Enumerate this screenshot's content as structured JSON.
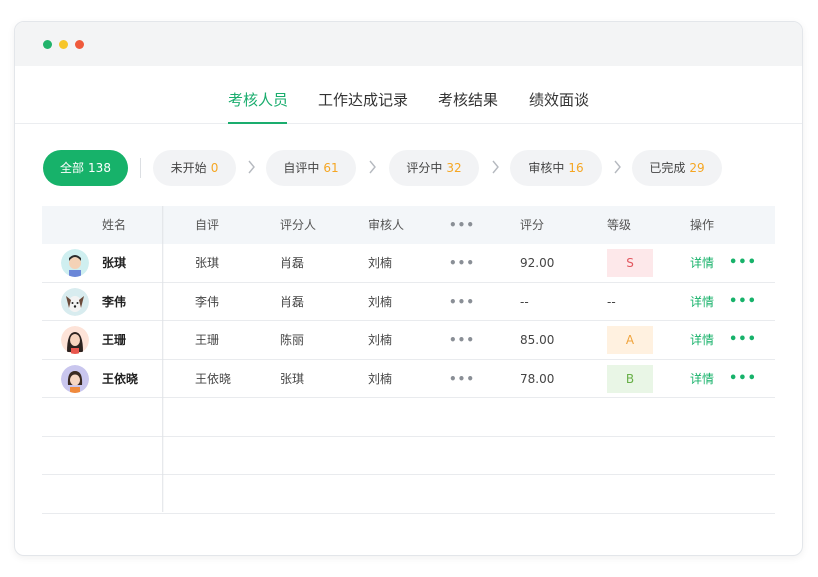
{
  "window": {
    "traffic_lights": [
      "#21b36b",
      "#f7c62a",
      "#ef5a3c"
    ]
  },
  "tabs": [
    {
      "label": "考核人员",
      "active": true
    },
    {
      "label": "工作达成记录",
      "active": false
    },
    {
      "label": "考核结果",
      "active": false
    },
    {
      "label": "绩效面谈",
      "active": false
    }
  ],
  "filters": [
    {
      "label": "全部",
      "count": "138",
      "active": true
    },
    {
      "label": "未开始",
      "count": "0",
      "active": false
    },
    {
      "label": "自评中",
      "count": "61",
      "active": false
    },
    {
      "label": "评分中",
      "count": "32",
      "active": false
    },
    {
      "label": "审核中",
      "count": "16",
      "active": false
    },
    {
      "label": "已完成",
      "count": "29",
      "active": false
    }
  ],
  "table": {
    "columns": [
      "姓名",
      "自评",
      "评分人",
      "审核人",
      "•••",
      "评分",
      "等级",
      "操作"
    ],
    "rows": [
      {
        "name": "张琪",
        "self": "张琪",
        "rater": "肖磊",
        "reviewer": "刘楠",
        "more": "•••",
        "score": "92.00",
        "grade": "S",
        "detail": "详情",
        "ops_more": "•••",
        "avatar": "avatar-man"
      },
      {
        "name": "李伟",
        "self": "李伟",
        "rater": "肖磊",
        "reviewer": "刘楠",
        "more": "•••",
        "score": "--",
        "grade": "--",
        "detail": "详情",
        "ops_more": "•••",
        "avatar": "avatar-dog"
      },
      {
        "name": "王珊",
        "self": "王珊",
        "rater": "陈丽",
        "reviewer": "刘楠",
        "more": "•••",
        "score": "85.00",
        "grade": "A",
        "detail": "详情",
        "ops_more": "•••",
        "avatar": "avatar-woman"
      },
      {
        "name": "王依晓",
        "self": "王依晓",
        "rater": "张琪",
        "reviewer": "刘楠",
        "more": "•••",
        "score": "78.00",
        "grade": "B",
        "detail": "详情",
        "ops_more": "•••",
        "avatar": "avatar-girl"
      }
    ],
    "empty_rows": 3
  },
  "colors": {
    "accent": "#17b26a",
    "count": "#f5a623",
    "grade_s": "#e2575f",
    "grade_a": "#f0a33b",
    "grade_b": "#68b048"
  }
}
